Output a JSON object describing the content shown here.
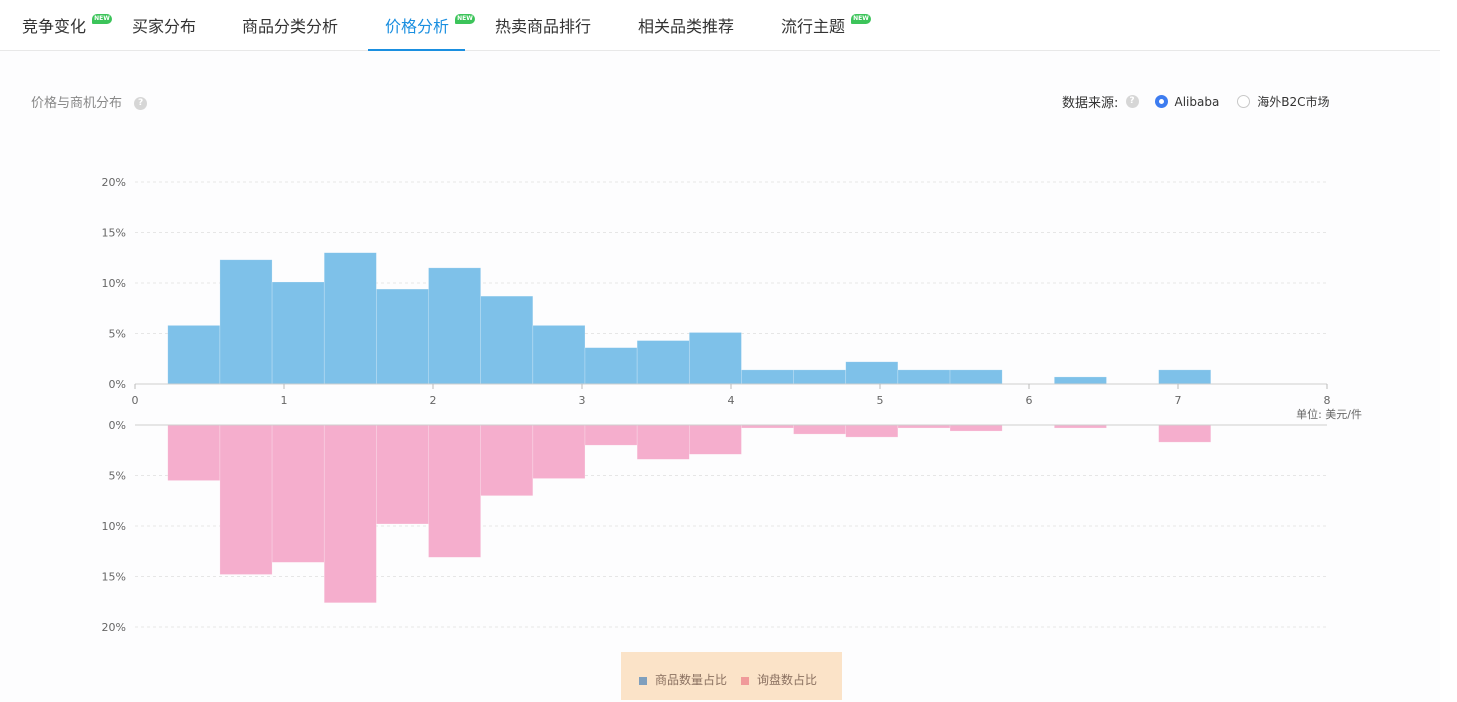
{
  "tabs": [
    {
      "label": "竞争变化",
      "new": true,
      "active": false
    },
    {
      "label": "买家分布",
      "new": false,
      "active": false
    },
    {
      "label": "商品分类分析",
      "new": false,
      "active": false
    },
    {
      "label": "价格分析",
      "new": true,
      "active": true
    },
    {
      "label": "热卖商品排行",
      "new": false,
      "active": false
    },
    {
      "label": "相关品类推荐",
      "new": false,
      "active": false
    },
    {
      "label": "流行主题",
      "new": true,
      "active": false
    }
  ],
  "new_badge_text": "NEW",
  "section": {
    "title": "价格与商机分布",
    "help": "?"
  },
  "source": {
    "label": "数据来源:",
    "help": "?",
    "options": [
      {
        "label": "Alibaba",
        "checked": true
      },
      {
        "label": "海外B2C市场",
        "checked": false
      }
    ]
  },
  "colors": {
    "accent": "#1a8fe0",
    "bar_top": "#7ec1e9",
    "bar_bottom": "#f5aecd",
    "legend_bg": "#fbe3c8",
    "new_badge": "#3cc45a"
  },
  "chart_data": {
    "type": "bar",
    "x_label": "单位: 美元/件",
    "x_ticks": [
      "0",
      "1",
      "2",
      "3",
      "4",
      "5",
      "6",
      "7",
      "8"
    ],
    "xlim": [
      0,
      8
    ],
    "top_ticks": [
      "20%",
      "15%",
      "10%",
      "5%",
      "0%"
    ],
    "bottom_ticks": [
      "0%",
      "5%",
      "10%",
      "15%",
      "20%"
    ],
    "ylim": [
      0,
      20
    ],
    "bin_width": 0.35,
    "bin_starts": [
      0.22,
      0.57,
      0.92,
      1.27,
      1.62,
      1.97,
      2.32,
      2.67,
      3.02,
      3.37,
      3.72,
      4.07,
      4.42,
      4.77,
      5.12,
      5.47,
      5.82,
      6.17,
      6.52,
      6.87
    ],
    "series": [
      {
        "name": "商品数量占比",
        "color": "#7ec1e9",
        "direction": "up",
        "values": [
          5.8,
          12.3,
          10.1,
          13.0,
          9.4,
          11.5,
          8.7,
          5.8,
          3.6,
          4.3,
          5.1,
          1.4,
          1.4,
          2.2,
          1.4,
          1.4,
          0,
          0.7,
          0,
          1.4
        ]
      },
      {
        "name": "询盘数占比",
        "color": "#f5aecd",
        "direction": "down",
        "values": [
          5.5,
          14.8,
          13.6,
          17.6,
          9.8,
          13.1,
          7.0,
          5.3,
          2.0,
          3.4,
          2.9,
          0.3,
          0.9,
          1.2,
          0.3,
          0.6,
          0,
          0.3,
          0,
          1.7
        ]
      }
    ],
    "grid": true,
    "legend_position": "bottom-center"
  }
}
